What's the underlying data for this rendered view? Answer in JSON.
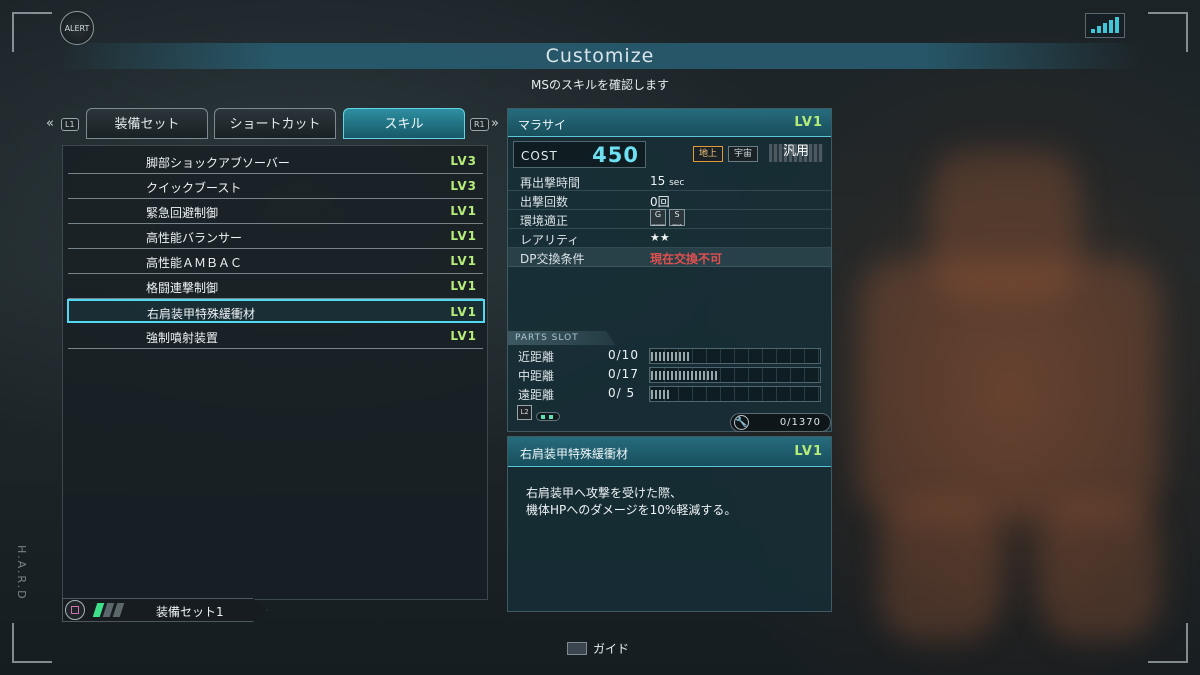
{
  "header": {
    "alert": "ALERT",
    "title": "Customize",
    "subtitle": "MSのスキルを確認します"
  },
  "tabs": {
    "left_hint": "L1",
    "right_hint": "R1",
    "items": [
      {
        "label": "装備セット"
      },
      {
        "label": "ショートカット"
      },
      {
        "label": "スキル"
      }
    ],
    "active_index": 2
  },
  "skills": [
    {
      "name": "脚部ショックアブソーバー",
      "level": "LV3"
    },
    {
      "name": "クイックブースト",
      "level": "LV3"
    },
    {
      "name": "緊急回避制御",
      "level": "LV1"
    },
    {
      "name": "高性能バランサー",
      "level": "LV1"
    },
    {
      "name": "高性能ＡＭＢＡＣ",
      "level": "LV1"
    },
    {
      "name": "格闘連撃制御",
      "level": "LV1"
    },
    {
      "name": "右肩装甲特殊緩衝材",
      "level": "LV1"
    },
    {
      "name": "強制噴射装置",
      "level": "LV1"
    }
  ],
  "selected_skill_index": 6,
  "equipment_set": {
    "label": "装備セット1",
    "button_icon": "square-button-icon"
  },
  "ms": {
    "name": "マラサイ",
    "level": "LV1",
    "cost_label": "COST",
    "cost": "450",
    "env_tags": [
      "地上",
      "宇宙",
      "汎用"
    ],
    "rows": [
      {
        "label": "再出撃時間",
        "value": "15",
        "unit": "sec"
      },
      {
        "label": "出撃回数",
        "value": "0回"
      },
      {
        "label": "環境適正",
        "value": ""
      },
      {
        "label": "レアリティ",
        "value": "★★"
      },
      {
        "label": "DP交換条件",
        "value": "現在交換不可"
      }
    ],
    "env_icons": [
      "G",
      "S"
    ],
    "env_icon_sub": [
      "GROUND",
      "SPACE"
    ],
    "parts_slot_label": "PARTS SLOT",
    "parts_slots": [
      {
        "label": "近距離",
        "value": "0/10",
        "fill": 0.23
      },
      {
        "label": "中距離",
        "value": "0/17",
        "fill": 0.39
      },
      {
        "label": "遠距離",
        "value": "0/ 5",
        "fill": 0.12
      }
    ],
    "l2_hint": "L2",
    "points": "0/1370"
  },
  "skill_detail": {
    "name": "右肩装甲特殊緩衝材",
    "level": "LV1",
    "line1": "右肩装甲へ攻撃を受けた際、",
    "line2": "機体HPへのダメージを10%軽減する。"
  },
  "footer": {
    "guide": "ガイド",
    "watermark": "H.A.R.D"
  },
  "colors": {
    "accent": "#52d8ef",
    "level_green": "#b6ec7a",
    "cost_cyan": "#6ee0f2",
    "warning_red": "#e0504f"
  }
}
